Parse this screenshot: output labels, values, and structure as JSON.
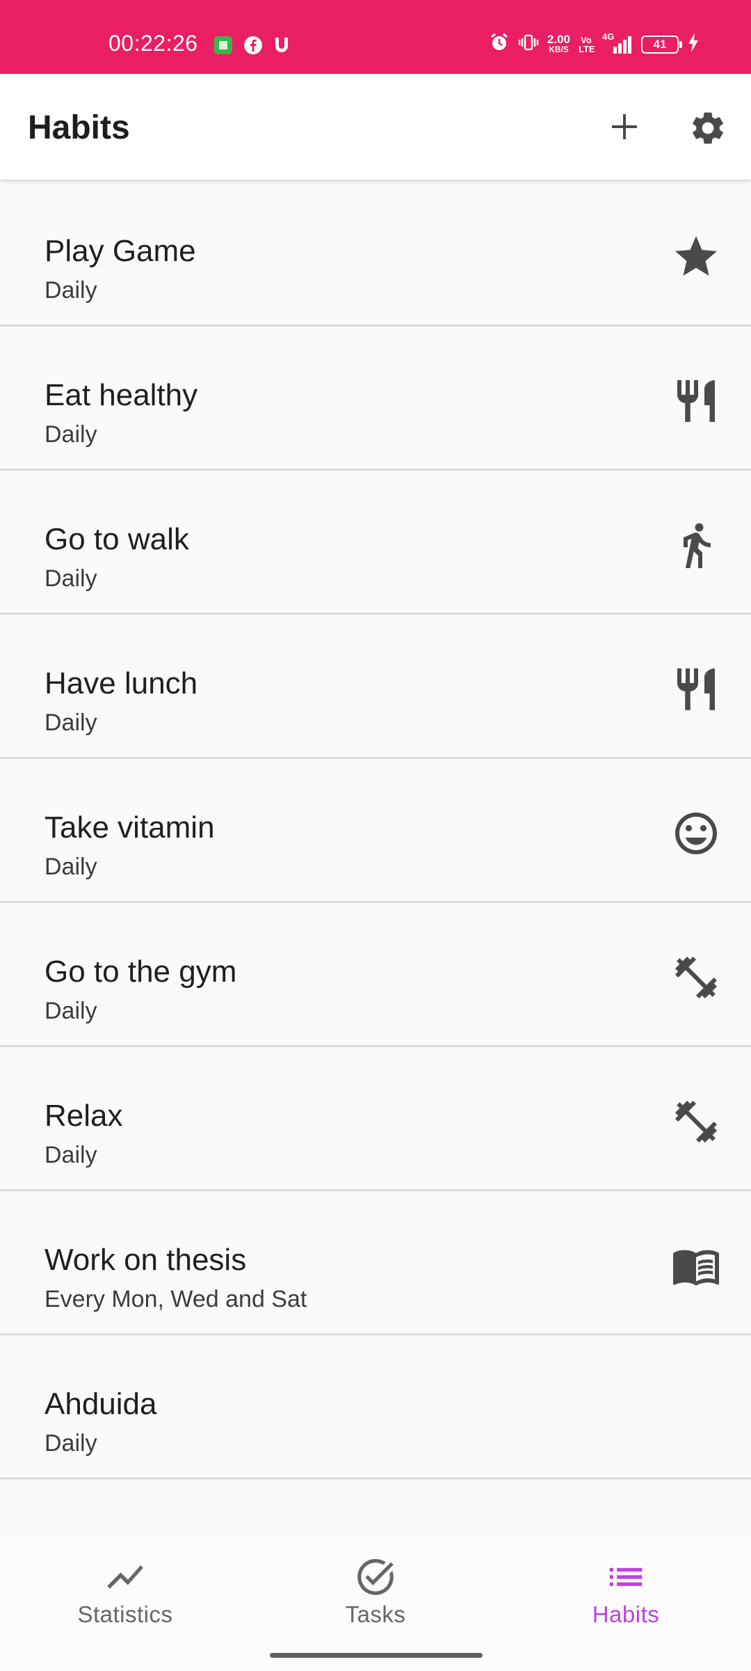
{
  "status_bar": {
    "time": "00:22:26",
    "net_speed_value": "2.00",
    "net_speed_unit": "KB/S",
    "volte": "Vo LTE",
    "network": "4G",
    "battery": "41"
  },
  "app_bar": {
    "title": "Habits",
    "add_icon": "plus-icon",
    "settings_icon": "gear-icon"
  },
  "habits": [
    {
      "name": "Play Game",
      "frequency": "Daily",
      "icon": "star-icon"
    },
    {
      "name": "Eat healthy",
      "frequency": "Daily",
      "icon": "restaurant-icon"
    },
    {
      "name": "Go to walk",
      "frequency": "Daily",
      "icon": "walk-icon"
    },
    {
      "name": "Have lunch",
      "frequency": "Daily",
      "icon": "restaurant-icon"
    },
    {
      "name": "Take vitamin",
      "frequency": "Daily",
      "icon": "smiley-icon"
    },
    {
      "name": "Go to the gym",
      "frequency": "Daily",
      "icon": "dumbbell-icon"
    },
    {
      "name": "Relax",
      "frequency": "Daily",
      "icon": "dumbbell-icon"
    },
    {
      "name": "Work on thesis",
      "frequency": "Every Mon, Wed and Sat",
      "icon": "book-icon"
    },
    {
      "name": "Ahduida",
      "frequency": "Daily",
      "icon": ""
    }
  ],
  "bottom_nav": {
    "items": [
      {
        "label": "Statistics",
        "icon": "trending-icon",
        "active": false
      },
      {
        "label": "Tasks",
        "icon": "check-circle-icon",
        "active": false
      },
      {
        "label": "Habits",
        "icon": "list-icon",
        "active": true
      }
    ],
    "active_color": "#c13fe0"
  },
  "colors": {
    "status_bar": "#e91e63",
    "icon": "#4a4a4a"
  }
}
